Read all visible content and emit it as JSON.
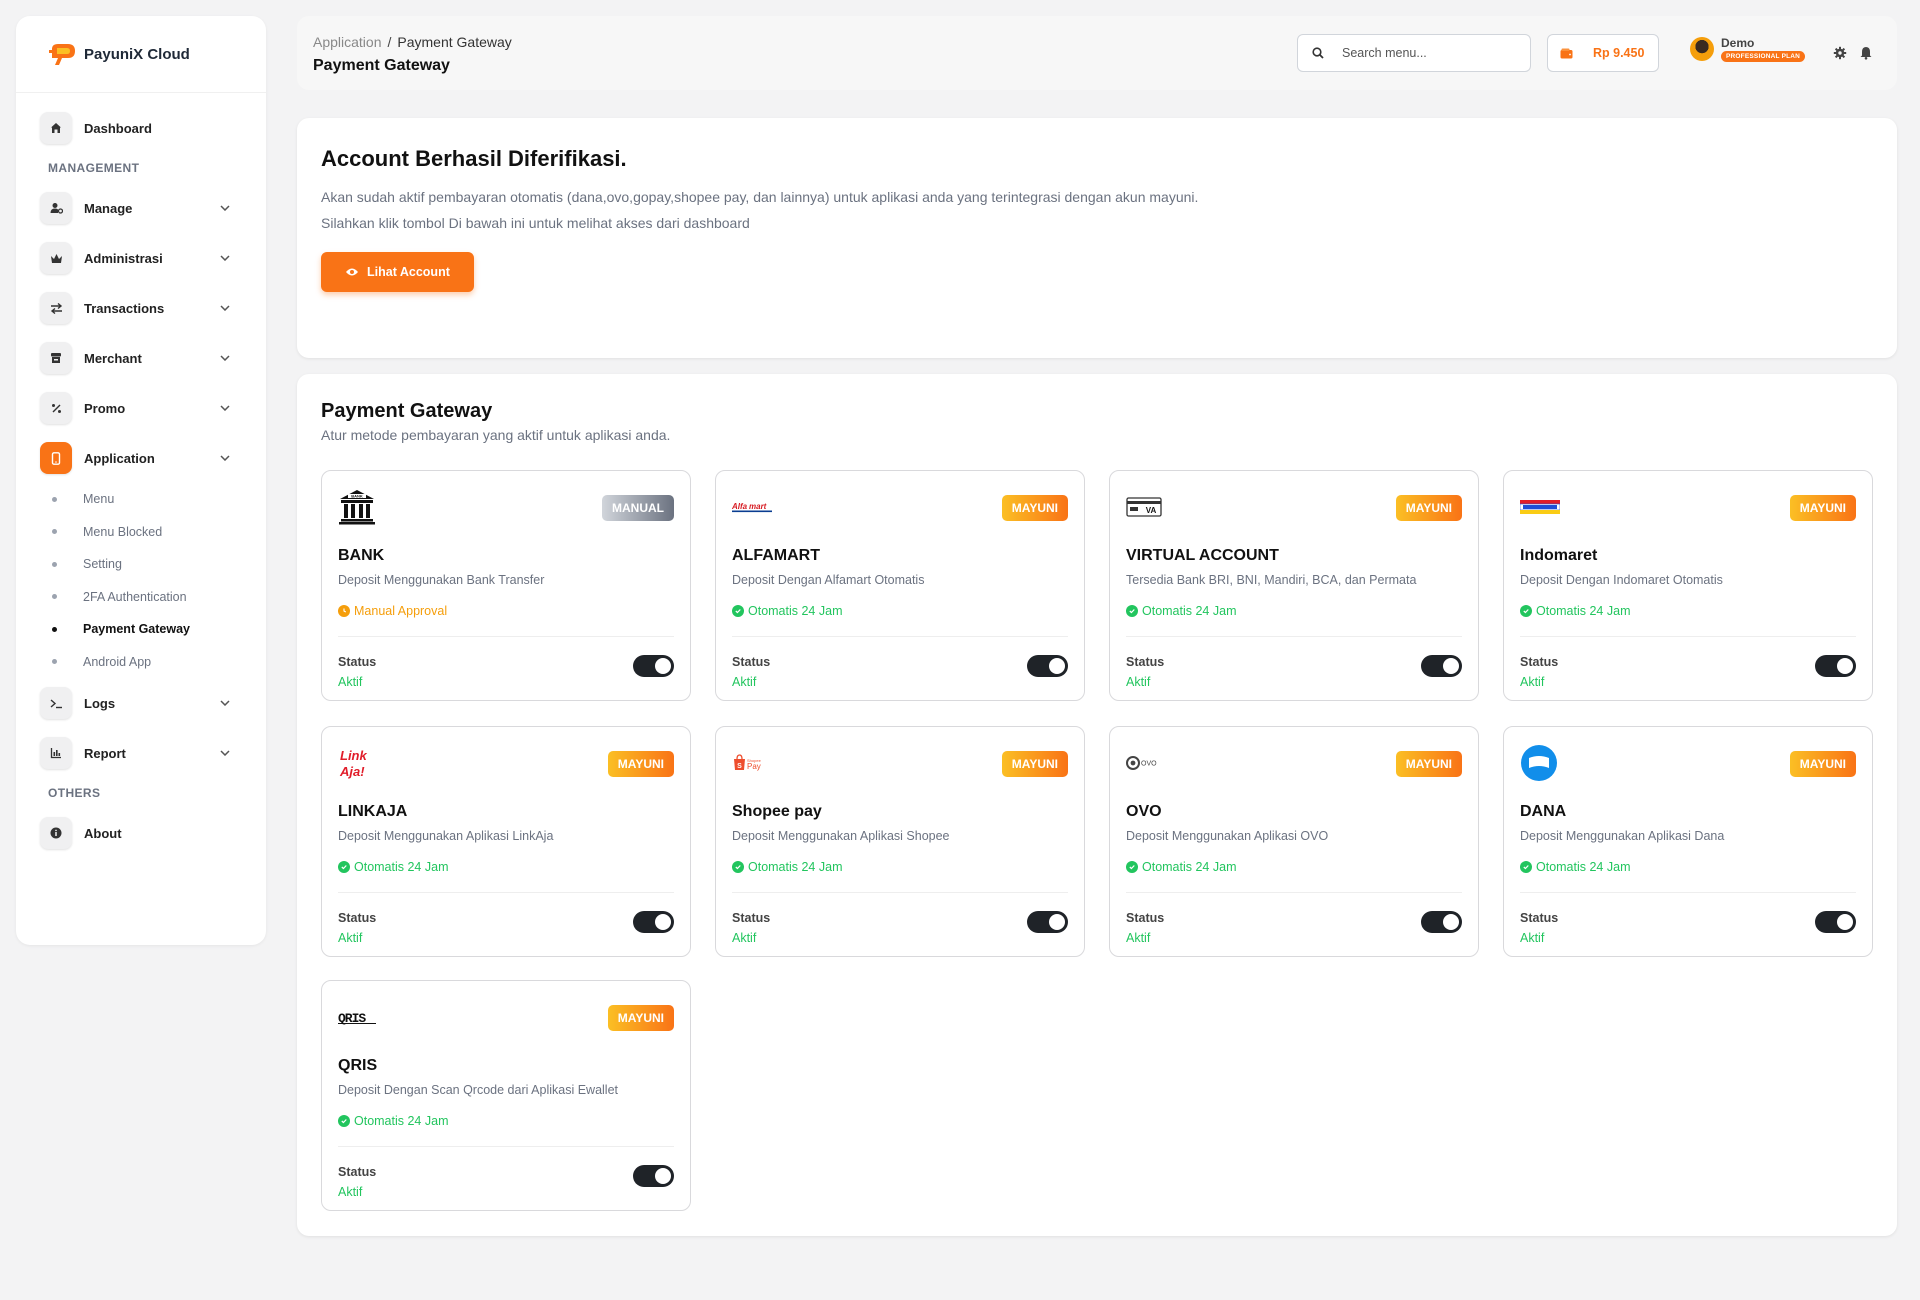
{
  "brand": {
    "name": "PayuniX Cloud"
  },
  "sidebar": {
    "dashboard": {
      "label": "Dashboard",
      "icon": "home-icon"
    },
    "sections": {
      "management": "MANAGEMENT",
      "others": "OTHERS"
    },
    "items": [
      {
        "label": "Manage",
        "icon": "user-gear-icon"
      },
      {
        "label": "Administrasi",
        "icon": "crown-icon"
      },
      {
        "label": "Transactions",
        "icon": "arrows-exchange-icon"
      },
      {
        "label": "Merchant",
        "icon": "store-icon"
      },
      {
        "label": "Promo",
        "icon": "percent-icon"
      },
      {
        "label": "Application",
        "icon": "mobile-icon",
        "active": true
      }
    ],
    "application_sub": [
      {
        "label": "Menu"
      },
      {
        "label": "Menu Blocked"
      },
      {
        "label": "Setting"
      },
      {
        "label": "2FA Authentication"
      },
      {
        "label": "Payment Gateway",
        "active": true
      },
      {
        "label": "Android App"
      }
    ],
    "logs": {
      "label": "Logs",
      "icon": "terminal-icon"
    },
    "report": {
      "label": "Report",
      "icon": "chart-icon"
    },
    "about": {
      "label": "About",
      "icon": "info-icon"
    }
  },
  "header": {
    "breadcrumb": {
      "parent": "Application",
      "separator": "/",
      "current": "Payment Gateway"
    },
    "title": "Payment Gateway",
    "search_placeholder": "Search menu...",
    "balance": "Rp 9.450",
    "user": {
      "name": "Demo",
      "plan": "PROFESSIONAL PLAN"
    }
  },
  "verify": {
    "title": "Account Berhasil Diferifikasi.",
    "text1": "Akan sudah aktif pembayaran otomatis (dana,ovo,gopay,shopee pay, dan lainnya) untuk aplikasi anda yang terintegrasi dengan akun mayuni.",
    "text2": "Silahkan klik tombol Di bawah ini untuk melihat akses dari dashboard",
    "button": "Lihat Account"
  },
  "gateway": {
    "title": "Payment Gateway",
    "subtitle": "Atur metode pembayaran yang aktif untuk aplikasi anda.",
    "status_label": "Status",
    "methods": [
      {
        "name": "BANK",
        "badge": "MANUAL",
        "desc": "Deposit Menggunakan Bank Transfer",
        "mode": "Manual Approval",
        "status": "Aktif",
        "logo": "bank-icon"
      },
      {
        "name": "ALFAMART",
        "badge": "MAYUNI",
        "desc": "Deposit Dengan Alfamart Otomatis",
        "mode": "Otomatis 24 Jam",
        "status": "Aktif",
        "logo": "alfamart-logo"
      },
      {
        "name": "VIRTUAL ACCOUNT",
        "badge": "MAYUNI",
        "desc": "Tersedia Bank BRI, BNI, Mandiri, BCA, dan Permata",
        "mode": "Otomatis 24 Jam",
        "status": "Aktif",
        "logo": "va-card-icon"
      },
      {
        "name": "Indomaret",
        "badge": "MAYUNI",
        "desc": "Deposit Dengan Indomaret Otomatis",
        "mode": "Otomatis 24 Jam",
        "status": "Aktif",
        "logo": "indomaret-logo"
      },
      {
        "name": "LINKAJA",
        "badge": "MAYUNI",
        "desc": "Deposit Menggunakan Aplikasi LinkAja",
        "mode": "Otomatis 24 Jam",
        "status": "Aktif",
        "logo": "linkaja-logo"
      },
      {
        "name": "Shopee pay",
        "badge": "MAYUNI",
        "desc": "Deposit Menggunakan Aplikasi Shopee",
        "mode": "Otomatis 24 Jam",
        "status": "Aktif",
        "logo": "shopeepay-logo"
      },
      {
        "name": "OVO",
        "badge": "MAYUNI",
        "desc": "Deposit Menggunakan Aplikasi OVO",
        "mode": "Otomatis 24 Jam",
        "status": "Aktif",
        "logo": "ovo-logo"
      },
      {
        "name": "DANA",
        "badge": "MAYUNI",
        "desc": "Deposit Menggunakan Aplikasi Dana",
        "mode": "Otomatis 24 Jam",
        "status": "Aktif",
        "logo": "dana-logo"
      },
      {
        "name": "QRIS",
        "badge": "MAYUNI",
        "desc": "Deposit Dengan Scan Qrcode dari Aplikasi Ewallet",
        "mode": "Otomatis 24 Jam",
        "status": "Aktif",
        "logo": "qris-logo"
      }
    ]
  },
  "colors": {
    "accent": "#f97316",
    "success": "#22c55e",
    "warning": "#f59e0b"
  }
}
